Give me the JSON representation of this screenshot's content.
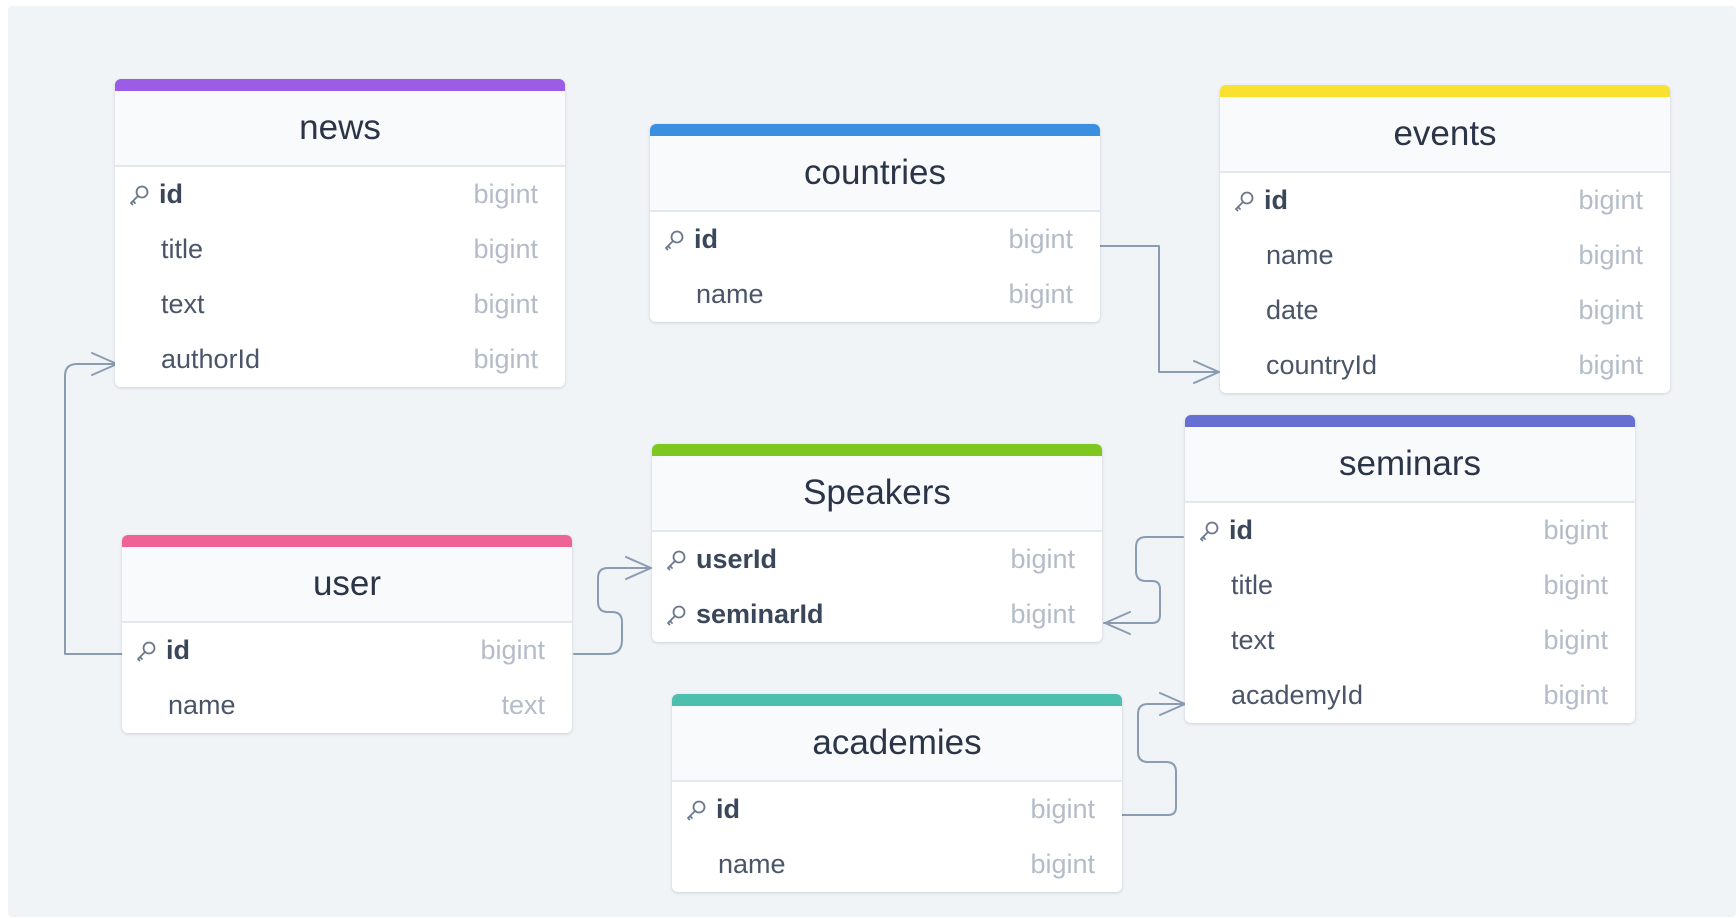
{
  "colors": {
    "background": "#f0f4f7",
    "relationship_line": "#8a9bb2",
    "news": "#9b5de5",
    "countries": "#3b8fe0",
    "events": "#f9e22f",
    "seminars": "#6570d2",
    "speakers": "#7dc71f",
    "user": "#ef6295",
    "academies": "#4cbfae"
  },
  "icons": {
    "primary_key": "key-icon"
  },
  "tables": {
    "news": {
      "name": "news",
      "columns": [
        {
          "name": "id",
          "type": "bigint",
          "pk": true
        },
        {
          "name": "title",
          "type": "bigint",
          "pk": false
        },
        {
          "name": "text",
          "type": "bigint",
          "pk": false
        },
        {
          "name": "authorId",
          "type": "bigint",
          "pk": false
        }
      ]
    },
    "countries": {
      "name": "countries",
      "columns": [
        {
          "name": "id",
          "type": "bigint",
          "pk": true
        },
        {
          "name": "name",
          "type": "bigint",
          "pk": false
        }
      ]
    },
    "events": {
      "name": "events",
      "columns": [
        {
          "name": "id",
          "type": "bigint",
          "pk": true
        },
        {
          "name": "name",
          "type": "bigint",
          "pk": false
        },
        {
          "name": "date",
          "type": "bigint",
          "pk": false
        },
        {
          "name": "countryId",
          "type": "bigint",
          "pk": false
        }
      ]
    },
    "speakers": {
      "name": "Speakers",
      "columns": [
        {
          "name": "userId",
          "type": "bigint",
          "pk": true
        },
        {
          "name": "seminarId",
          "type": "bigint",
          "pk": true
        }
      ]
    },
    "seminars": {
      "name": "seminars",
      "columns": [
        {
          "name": "id",
          "type": "bigint",
          "pk": true
        },
        {
          "name": "title",
          "type": "bigint",
          "pk": false
        },
        {
          "name": "text",
          "type": "bigint",
          "pk": false
        },
        {
          "name": "academyId",
          "type": "bigint",
          "pk": false
        }
      ]
    },
    "user": {
      "name": "user",
      "columns": [
        {
          "name": "id",
          "type": "bigint",
          "pk": true
        },
        {
          "name": "name",
          "type": "text",
          "pk": false
        }
      ]
    },
    "academies": {
      "name": "academies",
      "columns": [
        {
          "name": "id",
          "type": "bigint",
          "pk": true
        },
        {
          "name": "name",
          "type": "bigint",
          "pk": false
        }
      ]
    }
  },
  "relationships": [
    {
      "from": "user.id",
      "to": "news.authorId",
      "cardinality": "one-to-many"
    },
    {
      "from": "countries.id",
      "to": "events.countryId",
      "cardinality": "one-to-many"
    },
    {
      "from": "user.id",
      "to": "Speakers.userId",
      "cardinality": "one-to-many"
    },
    {
      "from": "seminars.id",
      "to": "Speakers.seminarId",
      "cardinality": "one-to-many"
    },
    {
      "from": "academies.id",
      "to": "seminars.academyId",
      "cardinality": "one-to-many"
    }
  ]
}
